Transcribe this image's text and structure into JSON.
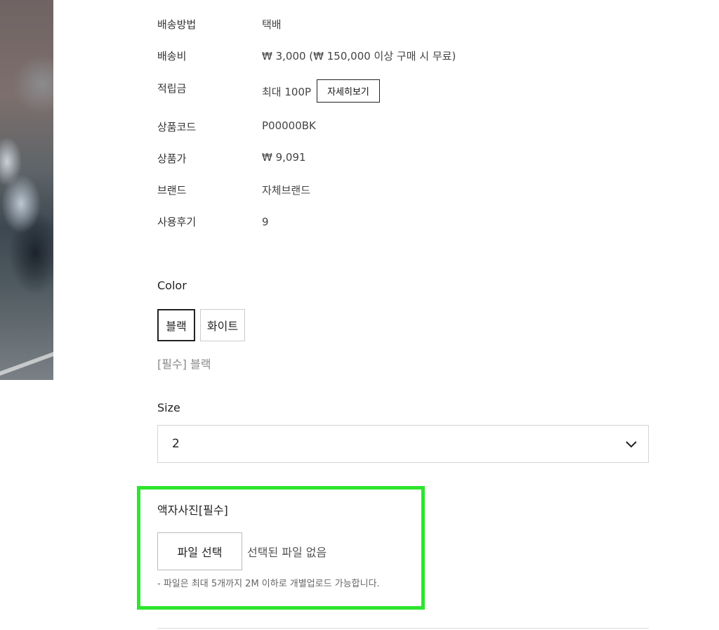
{
  "product_info": [
    {
      "label": "배송방법",
      "value": "택배"
    },
    {
      "label": "배송비",
      "value": "₩ 3,000 (₩ 150,000 이상 구매 시 무료)"
    },
    {
      "label": "적립금",
      "value": "최대 100P"
    },
    {
      "label": "상품코드",
      "value": "P00000BK"
    },
    {
      "label": "상품가",
      "value": "₩ 9,091"
    },
    {
      "label": "브랜드",
      "value": "자체브랜드"
    },
    {
      "label": "사용후기",
      "value": "9"
    }
  ],
  "points_detail_button": "자세히보기",
  "color_option": {
    "title": "Color",
    "swatches": [
      "블랙",
      "화이트"
    ],
    "selected_text": "[필수] 블랙"
  },
  "size_option": {
    "title": "Size",
    "selected_value": "2"
  },
  "upload": {
    "title": "액자사진[필수]",
    "button_label": "파일 선택",
    "status": "선택된 파일 없음",
    "hint": "- 파일은 최대 5개까지 2M 이하로 개별업로드 가능합니다."
  },
  "colors": {
    "highlight": "#2de52d"
  }
}
